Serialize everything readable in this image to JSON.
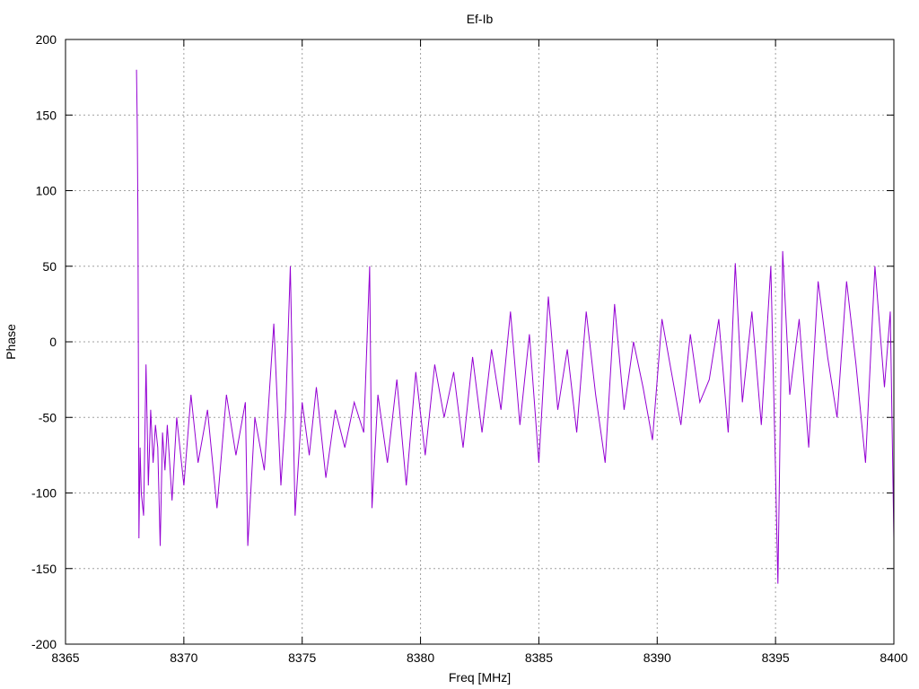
{
  "chart_data": {
    "type": "line",
    "title": "Ef-Ib",
    "xlabel": "Freq [MHz]",
    "ylabel": "Phase",
    "xlim": [
      8365,
      8400
    ],
    "ylim": [
      -200,
      200
    ],
    "x_ticks": [
      8365,
      8370,
      8375,
      8380,
      8385,
      8390,
      8395,
      8400
    ],
    "y_ticks": [
      -200,
      -150,
      -100,
      -50,
      0,
      50,
      100,
      150,
      200
    ],
    "grid": true,
    "legend": "none",
    "series": [
      {
        "color": "#9400d3",
        "x": [
          8368.0,
          8368.03,
          8368.06,
          8368.1,
          8368.15,
          8368.2,
          8368.3,
          8368.4,
          8368.5,
          8368.6,
          8368.7,
          8368.8,
          8368.9,
          8369.0,
          8369.1,
          8369.2,
          8369.3,
          8369.5,
          8369.7,
          8370.0,
          8370.3,
          8370.6,
          8371.0,
          8371.4,
          8371.8,
          8372.2,
          8372.6,
          8372.7,
          8373.0,
          8373.4,
          8373.8,
          8374.1,
          8374.3,
          8374.5,
          8374.7,
          8375.0,
          8375.3,
          8375.6,
          8376.0,
          8376.4,
          8376.8,
          8377.2,
          8377.6,
          8377.85,
          8377.95,
          8378.2,
          8378.6,
          8379.0,
          8379.4,
          8379.8,
          8380.2,
          8380.6,
          8381.0,
          8381.4,
          8381.8,
          8382.2,
          8382.6,
          8383.0,
          8383.4,
          8383.8,
          8384.2,
          8384.6,
          8385.0,
          8385.4,
          8385.8,
          8386.2,
          8386.6,
          8387.0,
          8387.4,
          8387.8,
          8388.2,
          8388.6,
          8389.0,
          8389.4,
          8389.8,
          8390.2,
          8390.6,
          8391.0,
          8391.4,
          8391.8,
          8392.2,
          8392.6,
          8393.0,
          8393.3,
          8393.6,
          8394.0,
          8394.4,
          8394.8,
          8395.0,
          8395.1,
          8395.3,
          8395.6,
          8396.0,
          8396.4,
          8396.8,
          8397.2,
          8397.6,
          8398.0,
          8398.4,
          8398.8,
          8399.2,
          8399.6,
          8399.85,
          8400.0
        ],
        "y": [
          180,
          145,
          82,
          -130,
          -70,
          -100,
          -115,
          -15,
          -95,
          -45,
          -80,
          -55,
          -70,
          -135,
          -60,
          -85,
          -55,
          -105,
          -50,
          -95,
          -35,
          -80,
          -45,
          -110,
          -35,
          -75,
          -40,
          -135,
          -50,
          -85,
          12,
          -95,
          -45,
          50,
          -115,
          -40,
          -75,
          -30,
          -90,
          -45,
          -70,
          -40,
          -60,
          50,
          -110,
          -35,
          -80,
          -25,
          -95,
          -20,
          -75,
          -15,
          -50,
          -20,
          -70,
          -10,
          -60,
          -5,
          -45,
          20,
          -55,
          5,
          -80,
          30,
          -45,
          -5,
          -60,
          20,
          -35,
          -80,
          25,
          -45,
          0,
          -30,
          -65,
          15,
          -20,
          -55,
          5,
          -40,
          -25,
          15,
          -60,
          52,
          -40,
          20,
          -55,
          50,
          -85,
          -160,
          60,
          -35,
          15,
          -70,
          40,
          -10,
          -50,
          40,
          -15,
          -80,
          50,
          -30,
          20,
          -130
        ]
      }
    ]
  }
}
